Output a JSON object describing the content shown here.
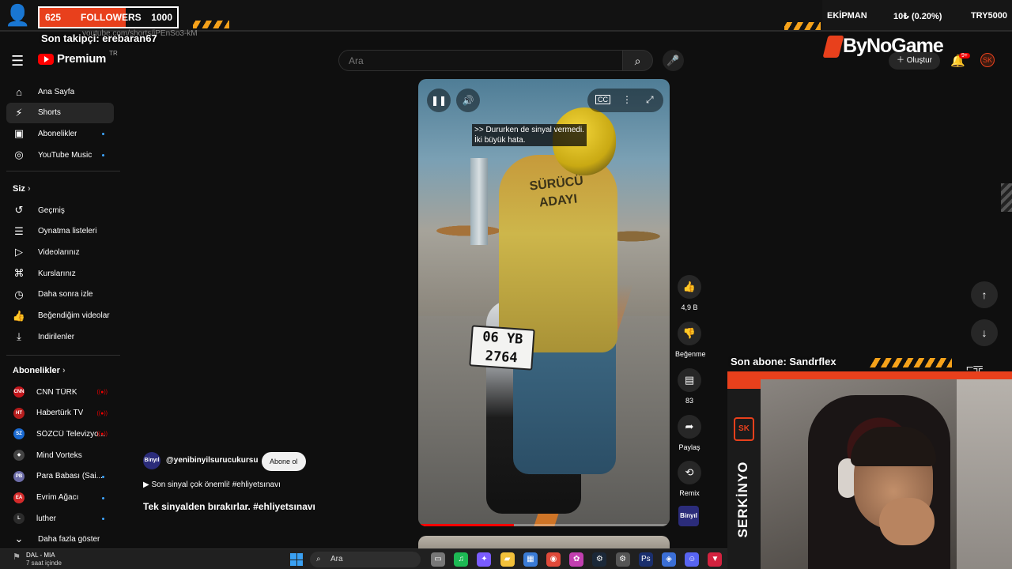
{
  "overlay": {
    "follower_count": "625",
    "follower_label": "FOLLOWERS",
    "follower_goal": "1000",
    "follower_progress": 0.625,
    "last_follower": "Son takipçi: erebaran67",
    "ghost_url": "youtube.com/shorts/iPEnSo3-kM",
    "ticker_label": "EKİPMAN",
    "ticker_change": "10₺ (0.20%)",
    "ticker_code": "TRY5000",
    "brand": "ByNoGame",
    "last_sub": "Son abone: Sandrflex",
    "streamer_name": "SERKİNYO",
    "streamer_logo": "SK"
  },
  "masthead": {
    "logo_text": "Premium",
    "logo_region": "TR",
    "search_placeholder": "Ara",
    "create_label": "Oluştur",
    "notif_badge": "9+"
  },
  "sidebar": {
    "main": [
      {
        "label": "Ana Sayfa",
        "icon": "home-icon",
        "glyph": "⌂"
      },
      {
        "label": "Shorts",
        "icon": "shorts-icon",
        "glyph": "⚡"
      },
      {
        "label": "Abonelikler",
        "icon": "subscriptions-icon",
        "glyph": "▣"
      },
      {
        "label": "YouTube Music",
        "icon": "music-icon",
        "glyph": "◎"
      }
    ],
    "you_header": "Siz",
    "you": [
      {
        "label": "Geçmiş",
        "icon": "history-icon",
        "glyph": "↺"
      },
      {
        "label": "Oynatma listeleri",
        "icon": "playlists-icon",
        "glyph": "☰"
      },
      {
        "label": "Videolarınız",
        "icon": "your-videos-icon",
        "glyph": "▷"
      },
      {
        "label": "Kurslarınız",
        "icon": "courses-icon",
        "glyph": "⌘"
      },
      {
        "label": "Daha sonra izle",
        "icon": "watch-later-icon",
        "glyph": "◷"
      },
      {
        "label": "Beğendiğim videolar",
        "icon": "liked-icon",
        "glyph": "👍"
      },
      {
        "label": "İndirilenler",
        "icon": "downloads-icon",
        "glyph": "⤓"
      }
    ],
    "subs_header": "Abonelikler",
    "subs": [
      {
        "label": "CNN TÜRK",
        "color": "#c4161c",
        "abbr": "CNN"
      },
      {
        "label": "Habertürk TV",
        "color": "#b51d1d",
        "abbr": "HT"
      },
      {
        "label": "SÖZCÜ Televizyo...",
        "color": "#1a6ad1",
        "abbr": "SZ"
      },
      {
        "label": "Mind Vorteks",
        "color": "#444444",
        "abbr": "◆"
      },
      {
        "label": "Para Babası (Sai...",
        "color": "#6d6da8",
        "abbr": "PB"
      },
      {
        "label": "Evrim Ağacı",
        "color": "#d42a2a",
        "abbr": "EA"
      },
      {
        "label": "luther",
        "color": "#2b2b2b",
        "abbr": "L"
      }
    ],
    "show_more": "Daha fazla göster"
  },
  "player": {
    "caption_line1": ">> Dururken de sinyal vermedi.",
    "caption_line2": "İki büyük hata.",
    "vest_text_1": "SÜRÜCÜ",
    "vest_text_2": "ADAYI",
    "plate_line1": "06 YB",
    "plate_line2": "2764",
    "progress": 0.38
  },
  "actions": {
    "like_count": "4,9 B",
    "dislike_label": "Beğenme",
    "comment_count": "83",
    "share_label": "Paylaş",
    "remix_label": "Remix",
    "channel_thumb": "Binyıl"
  },
  "meta": {
    "channel_handle": "@yenibinyilsurucukursu",
    "avatar_text": "Binyıl",
    "subscribe_label": "Abone ol",
    "line": "▶ Son sinyal çok önemli! #ehliyetsınavı",
    "title": "Tek sinyalden bırakırlar. #ehliyetsınavı"
  },
  "taskbar": {
    "weather_line1": "DAL - MIA",
    "weather_line2": "7 saat içinde",
    "search_label": "Ara",
    "apps": [
      {
        "icon": "widgets-icon",
        "color": "#777"
      },
      {
        "icon": "spotify-icon",
        "color": "#1db954"
      },
      {
        "icon": "copilot-icon",
        "color": "#7a5cff"
      },
      {
        "icon": "file-explorer-icon",
        "color": "#f3c13a"
      },
      {
        "icon": "store-icon",
        "color": "#3a7bd5"
      },
      {
        "icon": "chrome-icon",
        "color": "#e04a3a"
      },
      {
        "icon": "photos-icon",
        "color": "#c23fb0"
      },
      {
        "icon": "steam-icon",
        "color": "#1b2838"
      },
      {
        "icon": "settings-icon",
        "color": "#555"
      },
      {
        "icon": "photoshop-icon",
        "color": "#1a2f6d"
      },
      {
        "icon": "app-icon",
        "color": "#3b6fd6"
      },
      {
        "icon": "discord-icon",
        "color": "#5865f2"
      },
      {
        "icon": "pocket-icon",
        "color": "#d3223f"
      }
    ]
  }
}
